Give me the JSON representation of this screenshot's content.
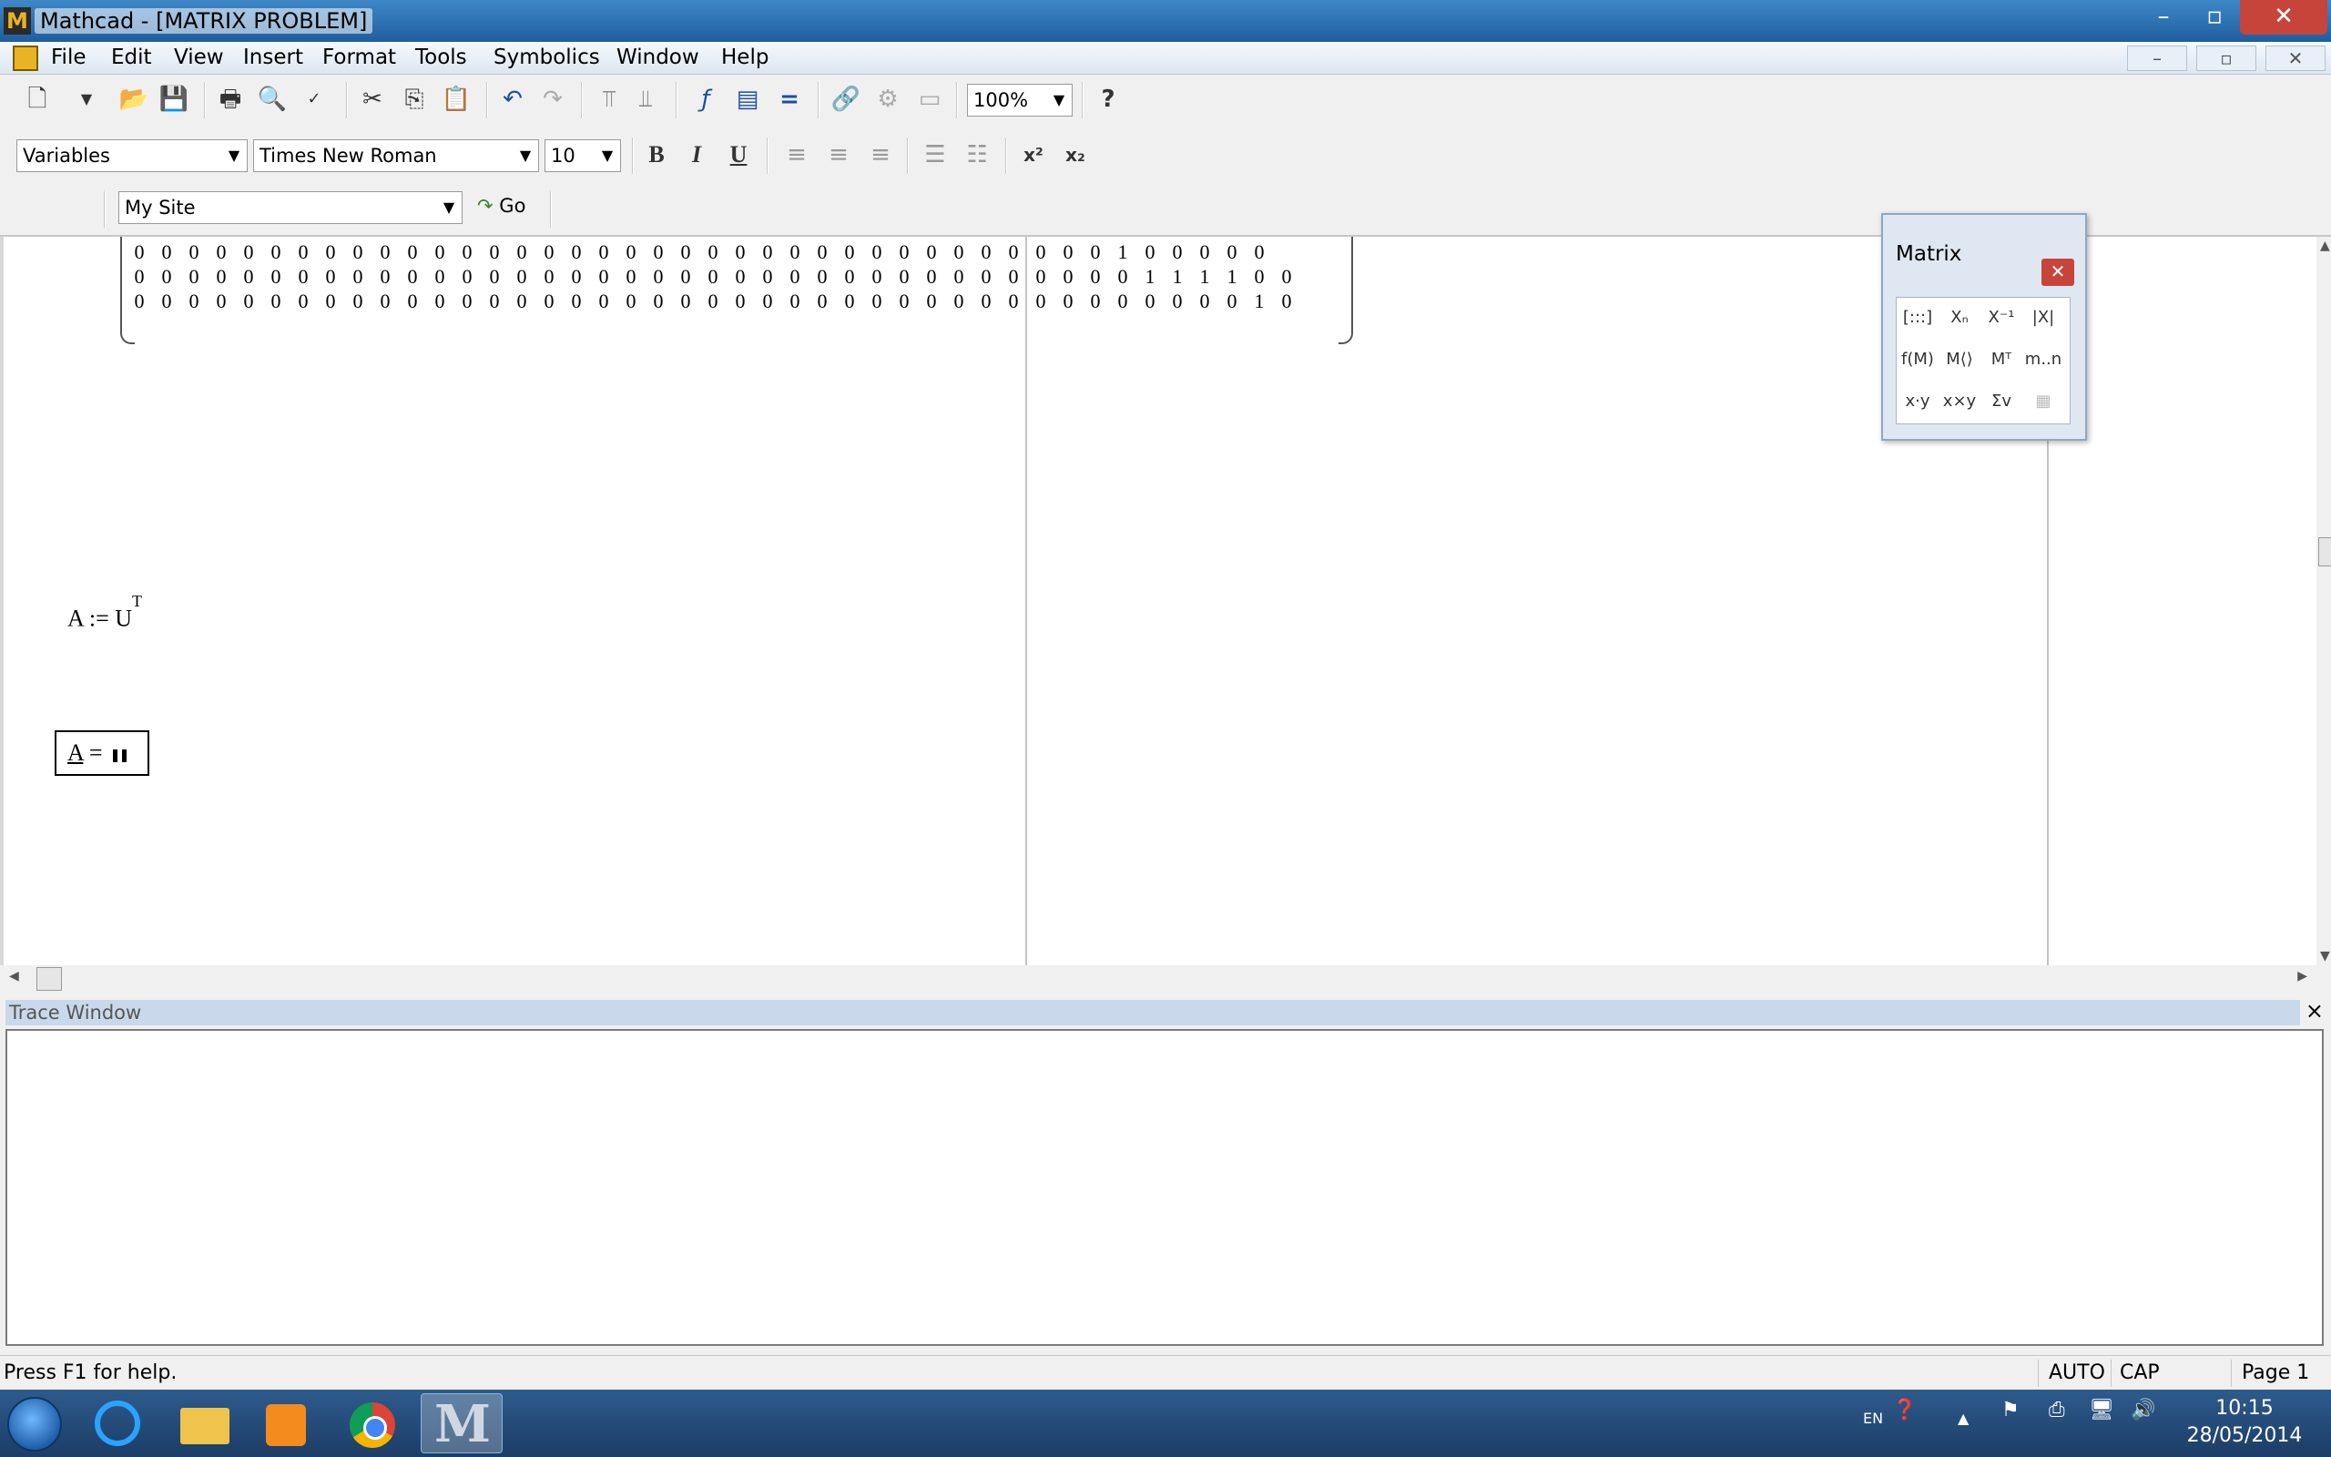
{
  "window": {
    "title": "Mathcad - [MATRIX PROBLEM]",
    "buttons": {
      "minimize": "–",
      "restore": "▫",
      "close": "✕"
    }
  },
  "menu": {
    "items": [
      "File",
      "Edit",
      "View",
      "Insert",
      "Format",
      "Tools",
      "Symbolics",
      "Window",
      "Help"
    ],
    "doc_buttons": {
      "minimize": "–",
      "restore": "▫",
      "close": "✕"
    }
  },
  "standard_toolbar": {
    "zoom_value": "100%"
  },
  "format_toolbar": {
    "style_value": "Variables",
    "font_value": "Times New Roman",
    "size_value": "10",
    "bold_label": "B",
    "italic_label": "I",
    "underline_label": "U"
  },
  "resources_toolbar": {
    "site_value": "My Site",
    "go_label": "Go"
  },
  "worksheet": {
    "matrix_rows": [
      [
        "0",
        "0",
        "0",
        "0",
        "0",
        "0",
        "0",
        "0",
        "0",
        "0",
        "0",
        "0",
        "0",
        "0",
        "0",
        "0",
        "0",
        "0",
        "0",
        "0",
        "0",
        "0",
        "0",
        "0",
        "0",
        "0",
        "0",
        "0",
        "0",
        "0",
        "0",
        "0",
        "0",
        "0",
        "0",
        "0",
        "1",
        "0",
        "0",
        "0",
        "0",
        "0"
      ],
      [
        "0",
        "0",
        "0",
        "0",
        "0",
        "0",
        "0",
        "0",
        "0",
        "0",
        "0",
        "0",
        "0",
        "0",
        "0",
        "0",
        "0",
        "0",
        "0",
        "0",
        "0",
        "0",
        "0",
        "0",
        "0",
        "0",
        "0",
        "0",
        "0",
        "0",
        "0",
        "0",
        "0",
        "0",
        "0",
        "0",
        "0",
        "1",
        "1",
        "1",
        "1",
        "0",
        "0"
      ],
      [
        "0",
        "0",
        "0",
        "0",
        "0",
        "0",
        "0",
        "0",
        "0",
        "0",
        "0",
        "0",
        "0",
        "0",
        "0",
        "0",
        "0",
        "0",
        "0",
        "0",
        "0",
        "0",
        "0",
        "0",
        "0",
        "0",
        "0",
        "0",
        "0",
        "0",
        "0",
        "0",
        "0",
        "0",
        "0",
        "0",
        "0",
        "0",
        "0",
        "0",
        "0",
        "1",
        "0"
      ]
    ],
    "assign": {
      "lhs": "A",
      "op": ":=",
      "rhs": "U",
      "sup": "T"
    },
    "eval": {
      "var": "A",
      "op": "="
    }
  },
  "palette": {
    "title": "Matrix",
    "close": "✕",
    "buttons": [
      "[:::]",
      "Xₙ",
      "X⁻¹",
      "|X|",
      "f(M)",
      "M⟨⟩",
      "Mᵀ",
      "m..n",
      "x·y",
      "x×y",
      "Σv",
      "▦"
    ]
  },
  "trace": {
    "title": "Trace Window",
    "close": "×"
  },
  "status": {
    "help": "Press F1 for help.",
    "mode": "AUTO",
    "caps": "CAP",
    "page": "Page 1"
  },
  "taskbar": {
    "lang": "EN",
    "time": "10:15",
    "date": "28/05/2014"
  }
}
